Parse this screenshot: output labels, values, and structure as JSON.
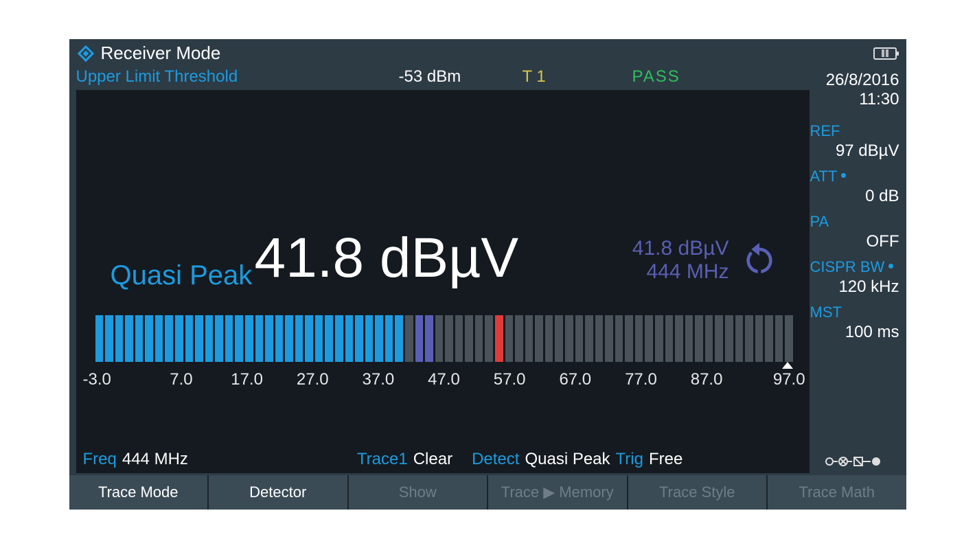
{
  "header": {
    "title": "Receiver Mode"
  },
  "status": {
    "threshold_label": "Upper Limit Threshold",
    "threshold_value": "-53 dBm",
    "trace_indicator": "T 1",
    "pass_fail": "PASS"
  },
  "side": {
    "date": "26/8/2016",
    "time": "11:30",
    "params": [
      {
        "key": "REF",
        "value": "97 dBµV",
        "dot": false
      },
      {
        "key": "ATT",
        "value": "0 dB",
        "dot": true
      },
      {
        "key": "PA",
        "value": "OFF",
        "dot": false
      },
      {
        "key": "CISPR BW",
        "value": "120 kHz",
        "dot": true
      },
      {
        "key": "MST",
        "value": "100 ms",
        "dot": false
      }
    ]
  },
  "reading": {
    "detector_label": "Quasi Peak",
    "value": "41.8 dBµV",
    "peak_hold_level": "41.8 dBµV",
    "peak_hold_freq": "444 MHz"
  },
  "bargraph": {
    "min": -3.0,
    "max": 97.0,
    "value": 41.8,
    "hold_value": 44.0,
    "limit_value": 54.0,
    "segments": 70,
    "scale_labels": [
      "-3.0",
      "7.0",
      "17.0",
      "27.0",
      "37.0",
      "47.0",
      "57.0",
      "67.0",
      "77.0",
      "87.0",
      "97.0"
    ]
  },
  "bottom": {
    "freq_k": "Freq",
    "freq_v": "444 MHz",
    "trace_k": "Trace1",
    "trace_v": "Clear",
    "detect_k": "Detect",
    "detect_v": "Quasi Peak",
    "trig_k": "Trig",
    "trig_v": "Free"
  },
  "softkeys": [
    {
      "label": "Trace Mode",
      "active": true
    },
    {
      "label": "Detector",
      "active": true
    },
    {
      "label": "Show",
      "active": false
    },
    {
      "label": "Trace ▶ Memory",
      "active": false
    },
    {
      "label": "Trace Style",
      "active": false
    },
    {
      "label": "Trace Math",
      "active": false
    }
  ]
}
